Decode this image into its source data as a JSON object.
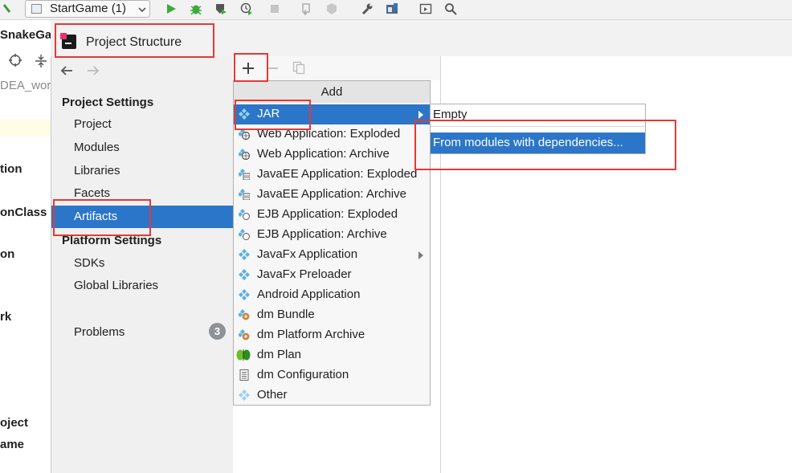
{
  "toolbar": {
    "run_config": "StartGame (1)"
  },
  "editor_strip": {
    "lines": [
      "SnakeGa",
      "DEA_wor",
      "tion",
      "onClass",
      "on",
      "rk",
      "oject",
      "ame"
    ]
  },
  "dialog": {
    "title": "Project Structure",
    "sidebar": {
      "project_settings": "Project Settings",
      "project": "Project",
      "modules": "Modules",
      "libraries": "Libraries",
      "facets": "Facets",
      "artifacts": "Artifacts",
      "platform_settings": "Platform Settings",
      "sdks": "SDKs",
      "global_libraries": "Global Libraries",
      "problems": "Problems",
      "problems_count": "3"
    },
    "add_menu": {
      "header": "Add",
      "items": [
        {
          "label": "JAR",
          "icon": "artifact-diamond-icon"
        },
        {
          "label": "Web Application: Exploded",
          "icon": "web-app-icon"
        },
        {
          "label": "Web Application: Archive",
          "icon": "web-app-icon"
        },
        {
          "label": "JavaEE Application: Exploded",
          "icon": "javaee-icon"
        },
        {
          "label": "JavaEE Application: Archive",
          "icon": "javaee-icon"
        },
        {
          "label": "EJB Application: Exploded",
          "icon": "ejb-icon"
        },
        {
          "label": "EJB Application: Archive",
          "icon": "ejb-icon"
        },
        {
          "label": "JavaFx Application",
          "icon": "artifact-diamond-icon"
        },
        {
          "label": "JavaFx Preloader",
          "icon": "artifact-diamond-icon"
        },
        {
          "label": "Android Application",
          "icon": "artifact-diamond-icon"
        },
        {
          "label": "dm Bundle",
          "icon": "bundle-icon"
        },
        {
          "label": "dm Platform Archive",
          "icon": "bundle-icon"
        },
        {
          "label": "dm Plan",
          "icon": "plan-icon"
        },
        {
          "label": "dm Configuration",
          "icon": "config-file-icon"
        },
        {
          "label": "Other",
          "icon": "artifact-diamond-icon"
        }
      ]
    },
    "submenu": {
      "empty": "Empty",
      "from_modules": "From modules with dependencies..."
    }
  },
  "colors": {
    "selection": "#2b76c9",
    "annotation": "#e53935"
  }
}
